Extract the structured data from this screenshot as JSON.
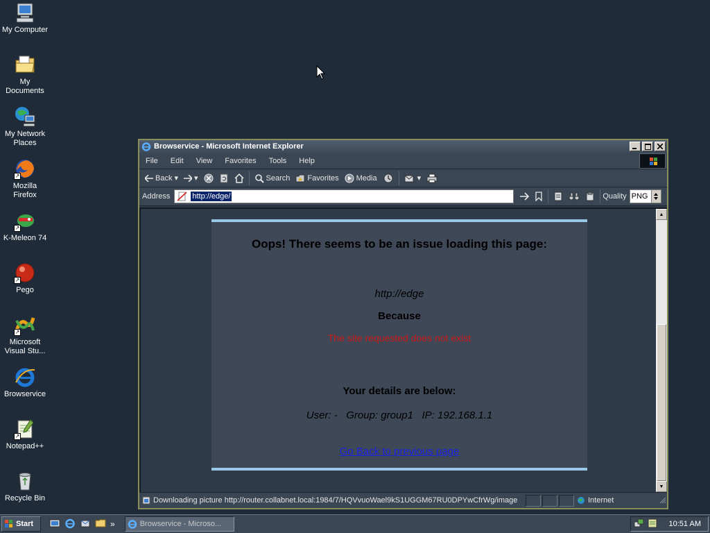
{
  "desktop": {
    "icons": [
      {
        "label": "My Computer",
        "icon": "my-computer-icon"
      },
      {
        "label": "My Documents",
        "icon": "folder-icon"
      },
      {
        "label": "My Network Places",
        "icon": "network-places-icon"
      },
      {
        "label": "Mozilla Firefox",
        "icon": "firefox-icon"
      },
      {
        "label": "K-Meleon 74",
        "icon": "k-meleon-icon"
      },
      {
        "label": "Pego",
        "icon": "pego-icon"
      },
      {
        "label": "Microsoft Visual Stu...",
        "icon": "visual-studio-icon"
      },
      {
        "label": "Browservice",
        "icon": "internet-explorer-icon"
      },
      {
        "label": "Notepad++",
        "icon": "notepad-icon"
      },
      {
        "label": "Recycle Bin",
        "icon": "recycle-bin-icon"
      }
    ]
  },
  "window": {
    "title": "Browservice - Microsoft Internet Explorer",
    "menu": [
      "File",
      "Edit",
      "View",
      "Favorites",
      "Tools",
      "Help"
    ],
    "toolbar": {
      "back": "Back",
      "search": "Search",
      "favorites": "Favorites",
      "media": "Media"
    },
    "address": {
      "label": "Address",
      "value": "http://edge/",
      "quality_label": "Quality",
      "quality_value": "PNG"
    },
    "page": {
      "heading": "Oops! There seems to be an issue loading this page:",
      "url": "http://edge",
      "because": "Because",
      "reason": "The site requested does not exist",
      "details_heading": "Your details are below:",
      "details": "User: -   Group: group1   IP: 192.168.1.1",
      "go_back": "Go Back to previous page"
    },
    "status": {
      "text": "Downloading picture http://router.collabnet.local:1984/7/HQVvuoWael9kS1UGGM67RU0DPYwCfrWg/image",
      "zone": "Internet"
    }
  },
  "taskbar": {
    "start": "Start",
    "task": "Browservice - Microso...",
    "clock": "10:51 AM"
  },
  "colors": {
    "desktop_bg": "#1f2b38",
    "card_border": "#9ac7e8",
    "error_red": "#cc1a1a",
    "link_blue": "#1a22e6"
  }
}
